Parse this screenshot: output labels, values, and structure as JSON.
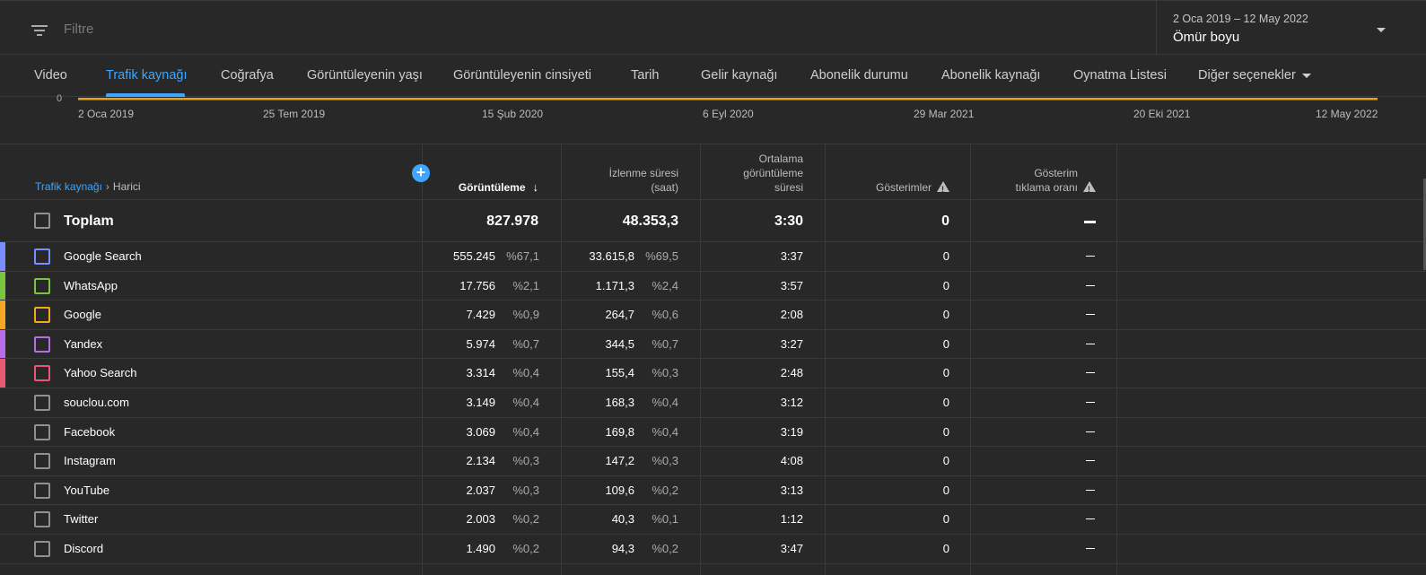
{
  "filter": {
    "placeholder": "Filtre"
  },
  "date": {
    "range": "2 Oca 2019 – 12 May 2022",
    "label": "Ömür boyu"
  },
  "tabs": [
    "Video",
    "Trafik kaynağı",
    "Coğrafya",
    "Görüntüleyenin yaşı",
    "Görüntüleyenin cinsiyeti",
    "Tarih",
    "Gelir kaynağı",
    "Abonelik durumu",
    "Abonelik kaynağı",
    "Oynatma Listesi",
    "Diğer seçenekler"
  ],
  "active_tab": "Trafik kaynağı",
  "chart": {
    "zero_label": "0",
    "x_ticks": [
      "2 Oca 2019",
      "25 Tem 2019",
      "15 Şub 2020",
      "6 Eyl 2020",
      "29 Mar 2021",
      "20 Eki 2021",
      "12 May 2022"
    ]
  },
  "table": {
    "breadcrumb": {
      "link": "Trafik kaynağı",
      "current": "Harici"
    },
    "add_symbol": "+",
    "headers": {
      "views": "Görüntüleme",
      "watch_time_1": "İzlenme süresi",
      "watch_time_2": "(saat)",
      "avg_1": "Ortalama",
      "avg_2": "görüntüleme",
      "avg_3": "süresi",
      "impressions": "Gösterimler",
      "ctr_1": "Gösterim",
      "ctr_2": "tıklama oranı"
    },
    "total": {
      "name": "Toplam",
      "views": "827.978",
      "watch": "48.353,3",
      "avg": "3:30",
      "impressions": "0",
      "ctr": "–"
    },
    "rows": [
      {
        "name": "Google Search",
        "views": "555.245",
        "views_pct": "%67,1",
        "watch": "33.615,8",
        "watch_pct": "%69,5",
        "avg": "3:37",
        "impressions": "0",
        "ctr": "–",
        "color": "#7b8cff"
      },
      {
        "name": "WhatsApp",
        "views": "17.756",
        "views_pct": "%2,1",
        "watch": "1.171,3",
        "watch_pct": "%2,4",
        "avg": "3:57",
        "impressions": "0",
        "ctr": "–",
        "color": "#7cc63f"
      },
      {
        "name": "Google",
        "views": "7.429",
        "views_pct": "%0,9",
        "watch": "264,7",
        "watch_pct": "%0,6",
        "avg": "2:08",
        "impressions": "0",
        "ctr": "–",
        "color": "#f5a623"
      },
      {
        "name": "Yandex",
        "views": "5.974",
        "views_pct": "%0,7",
        "watch": "344,5",
        "watch_pct": "%0,7",
        "avg": "3:27",
        "impressions": "0",
        "ctr": "–",
        "color": "#b86de8"
      },
      {
        "name": "Yahoo Search",
        "views": "3.314",
        "views_pct": "%0,4",
        "watch": "155,4",
        "watch_pct": "%0,3",
        "avg": "2:48",
        "impressions": "0",
        "ctr": "–",
        "color": "#e85a73"
      },
      {
        "name": "souclou.com",
        "views": "3.149",
        "views_pct": "%0,4",
        "watch": "168,3",
        "watch_pct": "%0,4",
        "avg": "3:12",
        "impressions": "0",
        "ctr": "–",
        "color": ""
      },
      {
        "name": "Facebook",
        "views": "3.069",
        "views_pct": "%0,4",
        "watch": "169,8",
        "watch_pct": "%0,4",
        "avg": "3:19",
        "impressions": "0",
        "ctr": "–",
        "color": ""
      },
      {
        "name": "Instagram",
        "views": "2.134",
        "views_pct": "%0,3",
        "watch": "147,2",
        "watch_pct": "%0,3",
        "avg": "4:08",
        "impressions": "0",
        "ctr": "–",
        "color": ""
      },
      {
        "name": "YouTube",
        "views": "2.037",
        "views_pct": "%0,3",
        "watch": "109,6",
        "watch_pct": "%0,2",
        "avg": "3:13",
        "impressions": "0",
        "ctr": "–",
        "color": ""
      },
      {
        "name": "Twitter",
        "views": "2.003",
        "views_pct": "%0,2",
        "watch": "40,3",
        "watch_pct": "%0,1",
        "avg": "1:12",
        "impressions": "0",
        "ctr": "–",
        "color": ""
      },
      {
        "name": "Discord",
        "views": "1.490",
        "views_pct": "%0,2",
        "watch": "94,3",
        "watch_pct": "%0,2",
        "avg": "3:47",
        "impressions": "0",
        "ctr": "–",
        "color": ""
      }
    ]
  },
  "colors": {
    "accent": "#3ea6ff",
    "background": "#282828",
    "chart_line": "#e3a21a"
  }
}
